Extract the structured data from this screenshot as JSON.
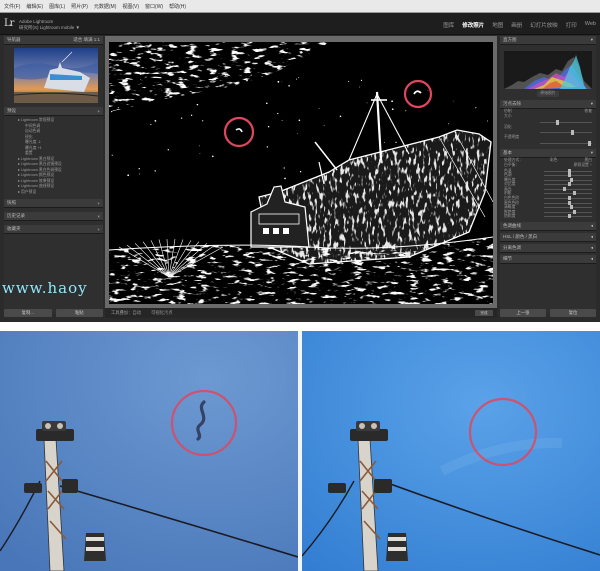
{
  "window": {
    "menu_items": [
      "文件(F)",
      "编辑(E)",
      "图库(L)",
      "照片(P)",
      "元数据(M)",
      "视图(V)",
      "窗口(W)",
      "帮助(H)"
    ],
    "logo": "Lr",
    "catalog_line1": "Adobe Lightroom",
    "catalog_line2": "研究所(S) Lightroom mobile ▼"
  },
  "modules": [
    "图库",
    "修改照片",
    "地图",
    "画册",
    "幻灯片放映",
    "打印",
    "Web"
  ],
  "active_module": "修改照片",
  "left_panel": {
    "navigator_header": "导航器",
    "navigator_modes": "适合  填满  1:1",
    "presets_header": "预设",
    "presets": [
      {
        "label": "Lightroom 常规预设",
        "level": 0
      },
      {
        "label": "中间色调",
        "level": 1
      },
      {
        "label": "自动色调",
        "level": 1
      },
      {
        "label": "锐化",
        "level": 1
      },
      {
        "label": "曝光度 -1",
        "level": 1
      },
      {
        "label": "曝光度 +1",
        "level": 1
      },
      {
        "label": "重置",
        "level": 1
      },
      {
        "label": "Lightroom 黑白预设",
        "level": 0
      },
      {
        "label": "Lightroom 黑白滤镜预设",
        "level": 0
      },
      {
        "label": "Lightroom 黑白色调预设",
        "level": 0
      },
      {
        "label": "Lightroom 颜色预设",
        "level": 0
      },
      {
        "label": "Lightroom 效果预设",
        "level": 0
      },
      {
        "label": "Lightroom 曲线预设",
        "level": 0
      },
      {
        "label": "用户预设",
        "level": 0
      }
    ],
    "snapshots_header": "快照",
    "history_header": "历史记录",
    "collections_header": "收藏夹",
    "copy_button": "复制...",
    "paste_button": "粘贴"
  },
  "toolbar": {
    "tool_overlay": "工具叠加：自动",
    "visualize_spots": "可视化污点",
    "done": "完成"
  },
  "right_panel": {
    "histogram_header": "直方图",
    "original_label": "原始照片",
    "spot_header": "污点去除",
    "mode_clone": "仿制",
    "mode_heal": "修复",
    "size_label": "大小",
    "feather_label": "羽化",
    "opacity_label": "不透明度",
    "basic_header": "基本",
    "treatment_label": "处理方式：",
    "treatment_color": "彩色",
    "treatment_bw": "黑白",
    "profile_label": "配置文件",
    "wb_label": "白平衡：",
    "wb_value": "原照设置 ÷",
    "temp_label": "色温",
    "tint_label": "色调",
    "exposure_label": "曝光度",
    "contrast_label": "对比度",
    "highlights_label": "高光",
    "shadows_label": "阴影",
    "whites_label": "白色色阶",
    "blacks_label": "黑色色阶",
    "presence_label": "偏好",
    "clarity_label": "清晰度",
    "vibrance_label": "鲜艳度",
    "saturation_label": "饱和度",
    "tone_curve_header": "色调曲线",
    "hsl_header": "HSL / 颜色 / 黑白",
    "split_header": "分离色调",
    "detail_header": "细节",
    "prev_button": "上一张",
    "reset_button": "复位"
  },
  "watermark": "www.haoy",
  "icons": {
    "collapse": "triangle-icon",
    "logo": "lightroom-logo-icon"
  },
  "colors": {
    "circle": "#e0475e",
    "watermark": "#9fe3f0",
    "panel": "#2f2f2f",
    "sky_before": "#5585c4",
    "sky_after": "#3a86d8"
  }
}
